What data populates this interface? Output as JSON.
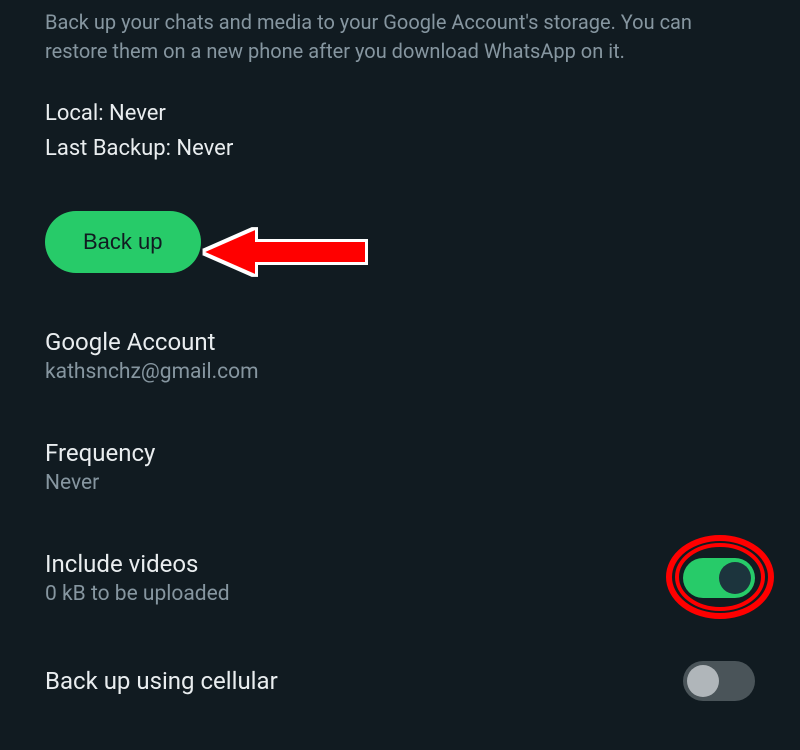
{
  "description": "Back up your chats and media to your Google Account's storage. You can restore them on a new phone after you download WhatsApp on it.",
  "local_line": "Local: Never",
  "last_backup_line": "Last Backup: Never",
  "backup_button_label": "Back up",
  "google_account": {
    "title": "Google Account",
    "value": "kathsnchz@gmail.com"
  },
  "frequency": {
    "title": "Frequency",
    "value": "Never"
  },
  "include_videos": {
    "title": "Include videos",
    "sub": "0 kB to be uploaded",
    "on": true
  },
  "cellular": {
    "title": "Back up using cellular",
    "on": false
  }
}
